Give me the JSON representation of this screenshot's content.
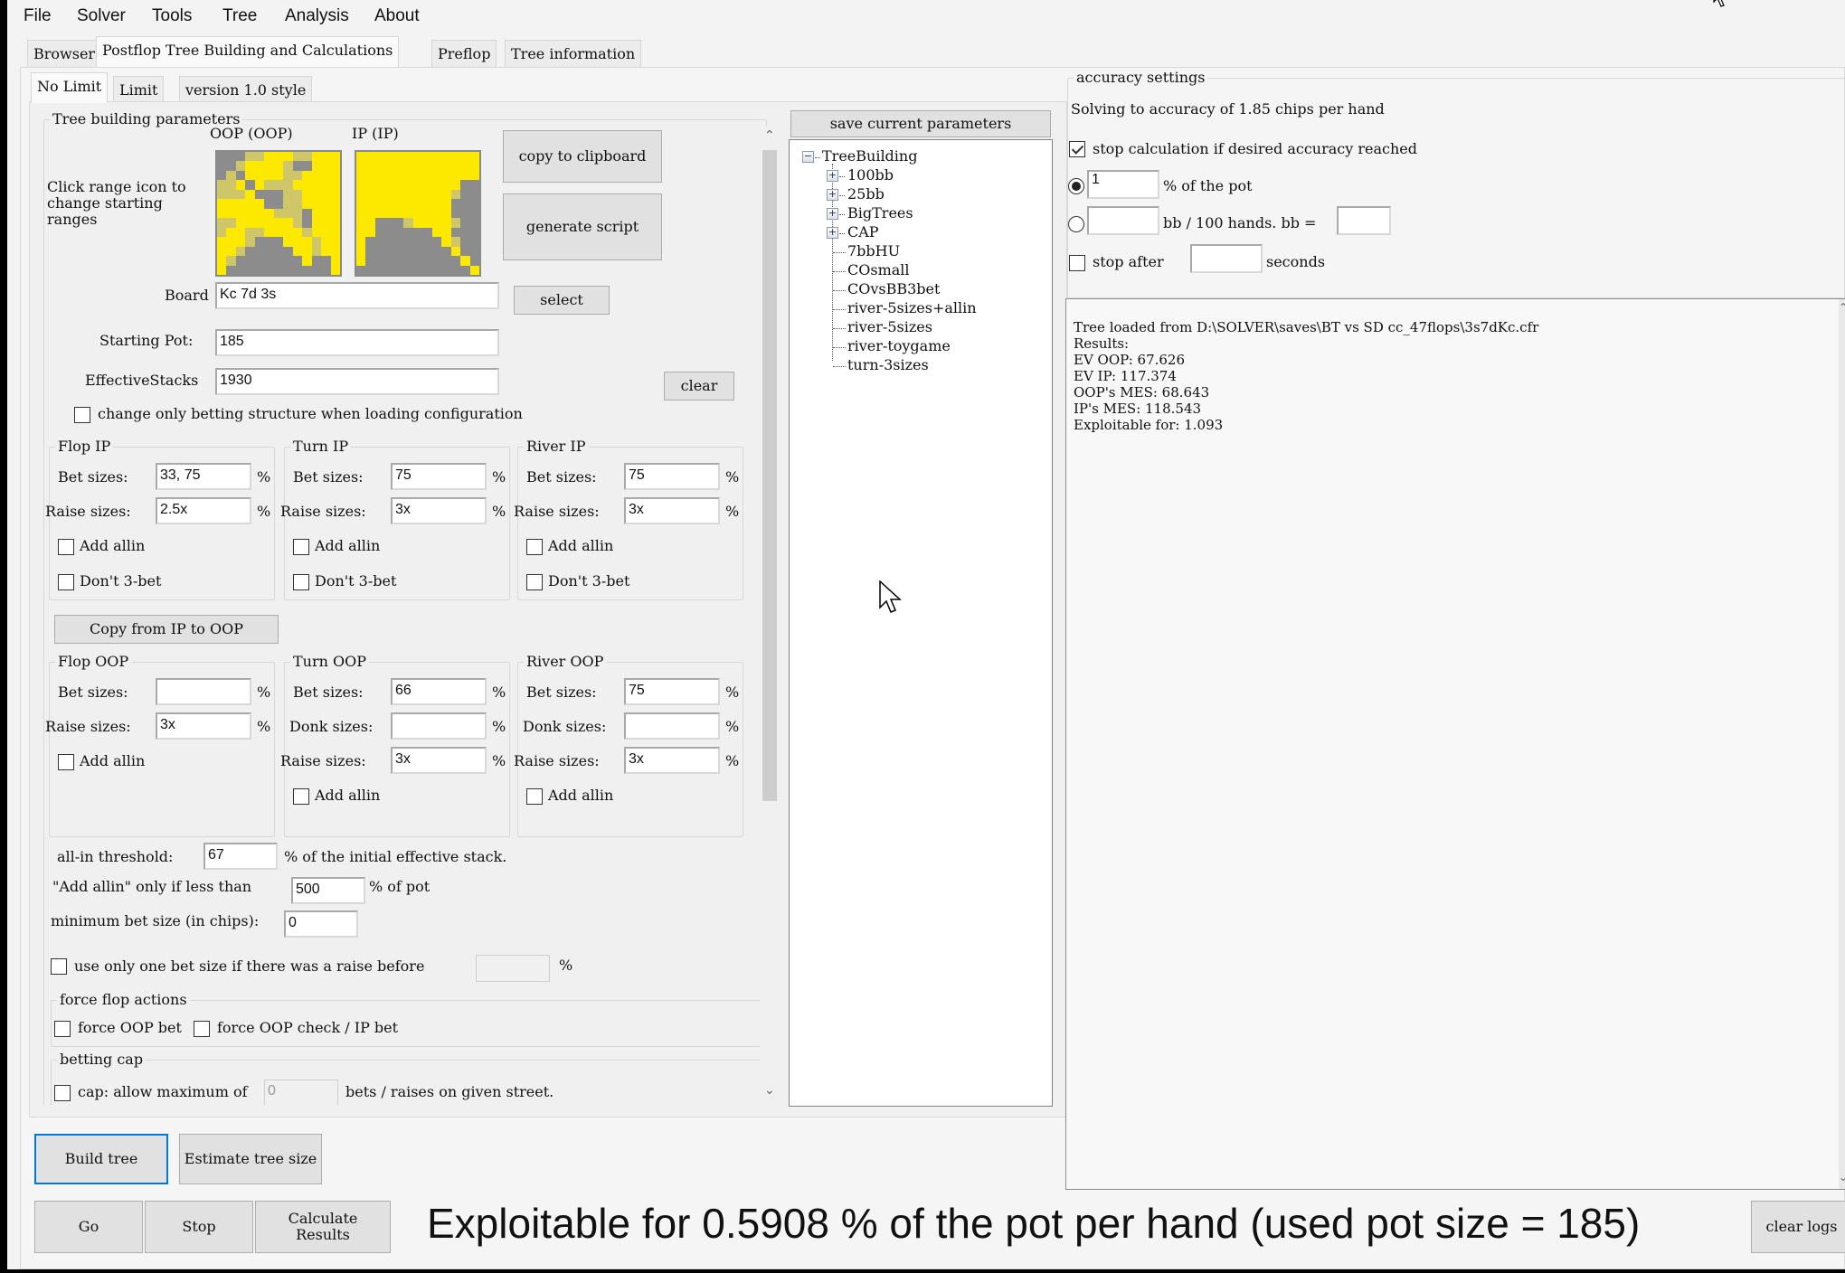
{
  "menu": [
    "File",
    "Solver",
    "Tools",
    "Tree",
    "Analysis",
    "About"
  ],
  "main_tabs": [
    {
      "label": "Browser",
      "active": false
    },
    {
      "label": "Postflop Tree Building and Calculations",
      "active": true
    },
    {
      "label": "Preflop",
      "active": false
    },
    {
      "label": "Tree information",
      "active": false
    }
  ],
  "sub_tabs": [
    {
      "label": "No Limit",
      "active": true
    },
    {
      "label": "Limit",
      "active": false
    },
    {
      "label": "version 1.0 style",
      "active": false
    }
  ],
  "tree_params": {
    "title": "Tree building parameters",
    "oop_label": "OOP (OOP)",
    "ip_label": "IP (IP)",
    "range_hint": "Click range icon to change starting ranges",
    "copy_clipboard": "copy to clipboard",
    "generate_script": "generate script",
    "board_label": "Board",
    "board_value": "Kc 7d 3s",
    "select_btn": "select",
    "pot_label": "Starting Pot:",
    "pot_value": "185",
    "stacks_label": "EffectiveStacks",
    "stacks_value": "1930",
    "clear_btn": "clear",
    "change_only_betting": "change only betting structure when loading configuration",
    "change_only_betting_checked": false
  },
  "ip_streets": [
    {
      "title": "Flop IP",
      "bet_label": "Bet sizes:",
      "bet": "33, 75",
      "raise_label": "Raise sizes:",
      "raise": "2.5x",
      "add_allin": "Add allin",
      "dont_3bet": "Don't 3-bet"
    },
    {
      "title": "Turn IP",
      "bet_label": "Bet sizes:",
      "bet": "75",
      "raise_label": "Raise sizes:",
      "raise": "3x",
      "add_allin": "Add allin",
      "dont_3bet": "Don't 3-bet"
    },
    {
      "title": "River IP",
      "bet_label": "Bet sizes:",
      "bet": "75",
      "raise_label": "Raise sizes:",
      "raise": "3x",
      "add_allin": "Add allin",
      "dont_3bet": "Don't 3-bet"
    }
  ],
  "copy_ip_oop": "Copy from IP to OOP",
  "oop_streets": [
    {
      "title": "Flop OOP",
      "bet_label": "Bet sizes:",
      "bet": "",
      "raise_label": "Raise sizes:",
      "raise": "3x",
      "add_allin": "Add allin"
    },
    {
      "title": "Turn OOP",
      "bet_label": "Bet sizes:",
      "bet": "66",
      "donk_label": "Donk sizes:",
      "donk": "",
      "raise_label": "Raise sizes:",
      "raise": "3x",
      "add_allin": "Add allin"
    },
    {
      "title": "River OOP",
      "bet_label": "Bet sizes:",
      "bet": "75",
      "donk_label": "Donk sizes:",
      "donk": "",
      "raise_label": "Raise sizes:",
      "raise": "3x",
      "add_allin": "Add allin"
    }
  ],
  "pct_symbol": "%",
  "extra": {
    "allin_threshold_label": "all-in threshold:",
    "allin_threshold_value": "67",
    "allin_threshold_suffix": "% of the initial effective stack.",
    "add_allin_only_label": "\"Add allin\" only if less than",
    "add_allin_only_value": "500",
    "add_allin_only_suffix": "% of pot",
    "min_bet_label": "minimum bet size (in chips):",
    "min_bet_value": "0",
    "one_bet_size_label": "use only one bet size if there was a raise before",
    "one_bet_size_value": "",
    "force_flop_title": "force flop actions",
    "force_oop_bet": "force OOP bet",
    "force_oop_check": "force OOP check / IP bet",
    "betting_cap_title": "betting cap",
    "cap_label": "cap: allow maximum of",
    "cap_value": "0",
    "cap_suffix": "bets / raises on given street."
  },
  "saved_configs": {
    "save_btn": "save current parameters",
    "root": "TreeBuilding",
    "folders": [
      "100bb",
      "25bb",
      "BigTrees",
      "CAP"
    ],
    "files": [
      "7bbHU",
      "COsmall",
      "COvsBB3bet",
      "river-5sizes+allin",
      "river-5sizes",
      "river-toygame",
      "turn-3sizes"
    ]
  },
  "accuracy": {
    "title": "accuracy settings",
    "solving_text": "Solving to accuracy of 1.85 chips per hand",
    "stop_if_reached": "stop calculation if desired accuracy reached",
    "stop_if_reached_checked": true,
    "pct_value": "1",
    "pct_suffix": "% of the pot",
    "bb_value": "",
    "bb_suffix": "bb / 100 hands. bb =",
    "bb_size_value": "",
    "stop_after_label": "stop after",
    "stop_after_value": "",
    "seconds_label": "seconds",
    "selected_mode": "pct"
  },
  "log_lines": [
    "Tree loaded from D:\\SOLVER\\saves\\BT vs SD cc_47flops\\3s7dKc.cfr",
    "Results:",
    "EV OOP: 67.626",
    "EV IP: 117.374",
    "OOP's MES: 68.643",
    "IP's MES: 118.543",
    "Exploitable for: 1.093"
  ],
  "bottom": {
    "build_tree": "Build tree",
    "estimate_tree": "Estimate tree size",
    "go": "Go",
    "stop": "Stop",
    "calculate": "Calculate Results",
    "status": "Exploitable for 0.5908 % of the pot per hand (used pot size = 185)",
    "clear_logs": "clear logs"
  },
  "colors": {
    "range_full": "#fde800",
    "range_none": "#8c8c8c",
    "range_mixed": "#cfc66a",
    "focus": "#0078d7"
  },
  "ranges": {
    "oop": [
      "NNNMMYYYMMYYY",
      "NNMYYYYMNNYYY",
      "NMNYYYYMMYYYY",
      "MMYNYMMMYYYYY",
      "MMMYNNNMMYYYY",
      "YYYYYNNMMYYYY",
      "YYYYYYMMMNYYY",
      "MMYYYYYYMNYYY",
      "MYYMMYYYYMYYY",
      "YYYMNNNYYYMYY",
      "YYMNNNNNYYMYY",
      "YMNNNNNNNYNNY",
      "YNNNNNNNNNNNY"
    ],
    "ip": [
      "YYYYYYYYYYYYY",
      "YYYYYYYYYYYYY",
      "YYYYYYYYYYYYY",
      "YYYYYYYYYYYNN",
      "YYYYYYYYYYMNN",
      "YYYYYYYYYYNNN",
      "YYYYYYYYYYNNN",
      "YYNNNMYYYYMNN",
      "YYNNNNNNYYNNN",
      "YNNNNNNNNYMNN",
      "YNNNNNNNNNYNN",
      "YNNNNNNNNNNYN",
      "NNNNNNNNNNNNY"
    ]
  }
}
